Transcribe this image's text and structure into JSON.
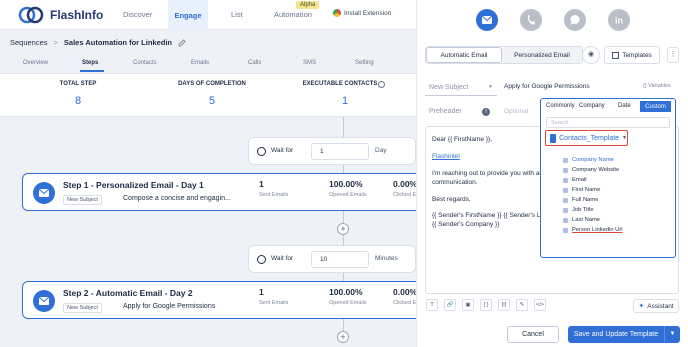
{
  "brand": {
    "name": "FlashInfo"
  },
  "nav": {
    "discover": "Discover",
    "engage": "Engage",
    "list": "List",
    "automation": "Automation",
    "alpha": "Alpha",
    "install": "Install Extension"
  },
  "breadcrumb": {
    "root": "Sequences",
    "sep": ">",
    "current": "Sales Automation for Linkedin"
  },
  "subtabs": [
    "Overview",
    "Steps",
    "Contacts",
    "Emails",
    "Calls",
    "SMS",
    "Setting"
  ],
  "stats": [
    {
      "label": "TOTAL STEP",
      "value": "8"
    },
    {
      "label": "DAYS OF COMPLETION",
      "value": "5"
    },
    {
      "label": "EXECUTABLE CONTACTS",
      "value": "1"
    }
  ],
  "wait1": {
    "label": "Wait for",
    "value": "1",
    "unit": "Day"
  },
  "wait2": {
    "label": "Wait for",
    "value": "10",
    "unit": "Minutes"
  },
  "step1": {
    "title": "Step 1 - Personalized Email - Day 1",
    "tag": "New Subject",
    "subject": "Compose a concise and engagin...",
    "sent_value": "1",
    "sent_label": "Sent Emails",
    "opened_value": "100.00%",
    "opened_label": "Opened Emails",
    "clicked_value": "0.00%",
    "clicked_label": "Clicked E"
  },
  "step2": {
    "title": "Step 2 - Automatic Email - Day 2",
    "tag": "New Subject",
    "subject": "Apply for Google Permissions",
    "sent_value": "1",
    "sent_label": "Sent Emails",
    "opened_value": "100.00%",
    "opened_label": "Opened Emails",
    "clicked_value": "0.00%",
    "clicked_label": "Clicked E"
  },
  "plus": "+",
  "panel": {
    "mode_auto": "Automatic Email",
    "mode_personal": "Personalized Email",
    "templates": "Templates",
    "more": "⋮",
    "subject_select": "New Subject",
    "subject_value": "Apply for Google Permissions",
    "variables": "{} Variables",
    "preheader": "Preheader",
    "optional": "Optional",
    "body": {
      "greeting": "Dear {{ FirstName }},",
      "link": "Flashintel",
      "l1": "I'm reaching out to provide you with ad",
      "l2": "communication.",
      "regards": "Best regards,",
      "l3": "{{ Sender's FirstName }} {{ Sender's Last",
      "l4": "{{ Sender's Company }}"
    },
    "toolbar": [
      "T",
      "🔗",
      "▣",
      "{ }",
      "{i}",
      "✎",
      "</>"
    ],
    "assistant": "Assistant",
    "cancel": "Cancel",
    "save": "Save and Update Template"
  },
  "vars": {
    "tabs": [
      "Commonly",
      "Company",
      "Date",
      "Custom"
    ],
    "search_placeholder": "Search",
    "template": "Contacts_Template",
    "fields": [
      "Company Name",
      "Company Website",
      "Email",
      "First Name",
      "Full Name",
      "Job Title",
      "Last Name",
      "Person Linkedin Url"
    ]
  }
}
